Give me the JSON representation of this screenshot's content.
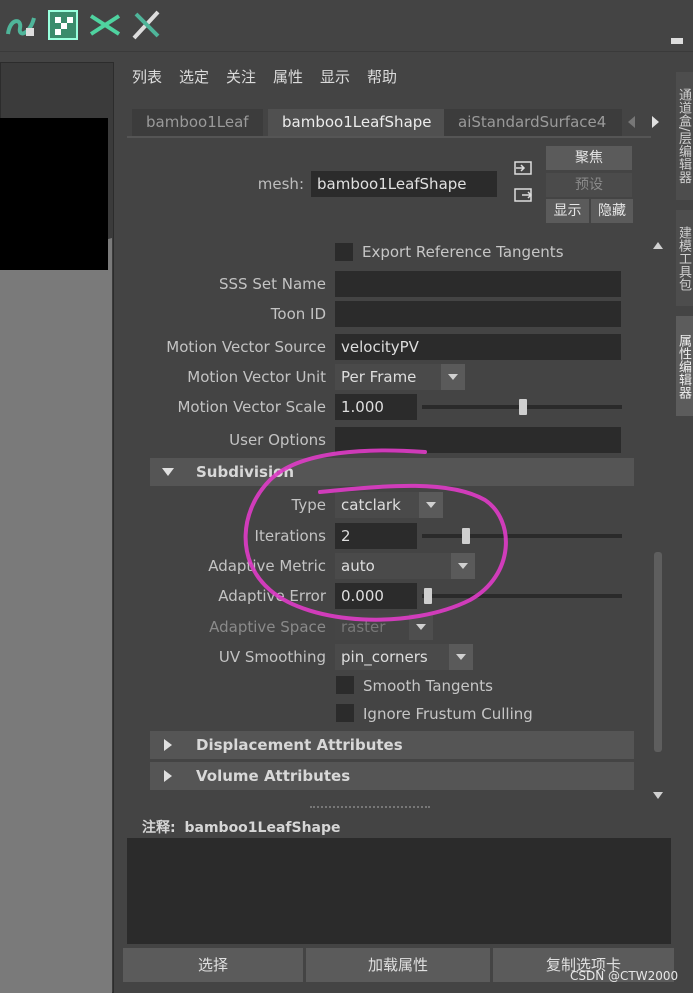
{
  "menu": [
    "列表",
    "选定",
    "关注",
    "属性",
    "显示",
    "帮助"
  ],
  "tabs": [
    "bamboo1Leaf",
    "bamboo1LeafShape",
    "aiStandardSurface4"
  ],
  "mesh": {
    "label": "mesh:",
    "value": "bamboo1LeafShape",
    "buttons": {
      "focus": "聚焦",
      "preset": "预设",
      "show": "显示",
      "hide": "隐藏"
    }
  },
  "attributes": {
    "export_ref_tangents": "Export Reference Tangents",
    "sss_set_name": {
      "label": "SSS Set Name",
      "value": ""
    },
    "toon_id": {
      "label": "Toon ID",
      "value": ""
    },
    "motion_vector_source": {
      "label": "Motion Vector Source",
      "value": "velocityPV"
    },
    "motion_vector_unit": {
      "label": "Motion Vector Unit",
      "value": "Per Frame"
    },
    "motion_vector_scale": {
      "label": "Motion Vector Scale",
      "value": "1.000",
      "slider": 0.5
    },
    "user_options": {
      "label": "User Options",
      "value": ""
    }
  },
  "subdivision": {
    "title": "Subdivision",
    "type": {
      "label": "Type",
      "value": "catclark"
    },
    "iterations": {
      "label": "Iterations",
      "value": "2",
      "slider": 0.2
    },
    "adaptive_metric": {
      "label": "Adaptive Metric",
      "value": "auto"
    },
    "adaptive_error": {
      "label": "Adaptive Error",
      "value": "0.000",
      "slider": 0.0
    },
    "adaptive_space": {
      "label": "Adaptive Space",
      "value": "raster"
    },
    "uv_smoothing": {
      "label": "UV Smoothing",
      "value": "pin_corners"
    },
    "smooth_tangents": "Smooth Tangents",
    "ignore_frustum": "Ignore Frustum Culling"
  },
  "sections": [
    "Displacement Attributes",
    "Volume Attributes"
  ],
  "notes": {
    "label": "注释:",
    "value": "bamboo1LeafShape"
  },
  "bottom_buttons": [
    "选择",
    "加载属性",
    "复制选项卡"
  ],
  "side_tabs": [
    "通道盒/层编辑器",
    "建模工具包",
    "属性编辑器"
  ],
  "watermark": "CSDN @CTW2000",
  "colors": {
    "annotation": "#e03cc8"
  }
}
